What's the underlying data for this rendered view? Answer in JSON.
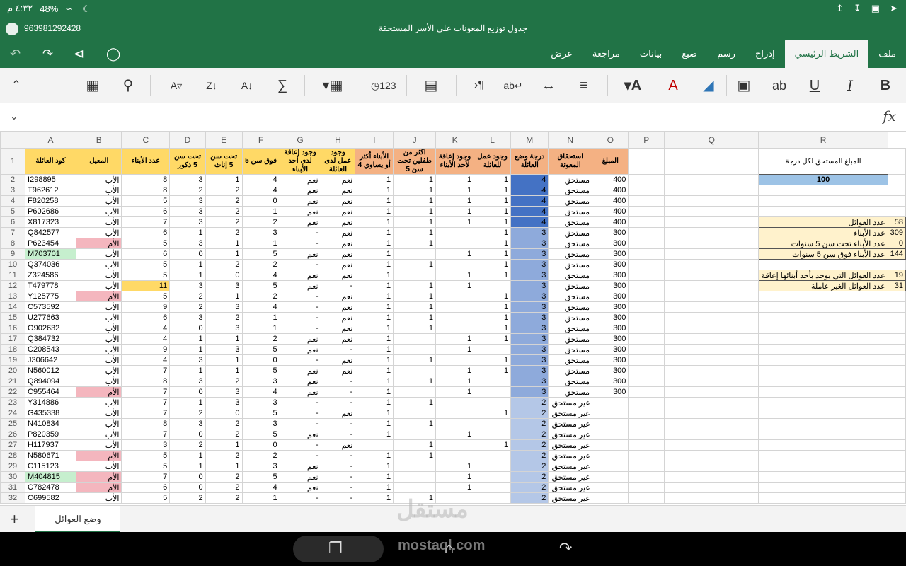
{
  "status": {
    "time": "٤:٣٢ م",
    "battery": "48%"
  },
  "title": {
    "phone": "963981292428",
    "doc": "جدول توزيع المعونات على الأسر المستحقة"
  },
  "menu": {
    "tabs": [
      "ملف",
      "الشريط الرئيسي",
      "إدراج",
      "رسم",
      "صيغ",
      "بيانات",
      "مراجعة",
      "عرض"
    ],
    "active": "الشريط الرئيسي"
  },
  "ribbon": {
    "icons": [
      "bold-icon",
      "italic-icon",
      "underline-icon",
      "strikethrough-icon",
      "borders-icon",
      "fill-color-icon",
      "font-color-icon",
      "font-color-dropdown-icon",
      "align-icon",
      "wrap-text-icon",
      "merge-icon",
      "rtl-icon",
      "format-icon",
      "number-format-icon",
      "insert-cells-icon",
      "autosum-icon",
      "sort-asc-icon",
      "sort-desc-icon",
      "filter-icon",
      "find-icon",
      "table-icon"
    ]
  },
  "formula": {
    "fx": "fx"
  },
  "columns": [
    "A",
    "B",
    "C",
    "D",
    "E",
    "F",
    "G",
    "H",
    "I",
    "J",
    "K",
    "L",
    "M",
    "N",
    "O",
    "P",
    "Q",
    "R"
  ],
  "headers": {
    "A": "كود العائلة",
    "B": "المعيل",
    "C": "عدد الأبناء",
    "D": "تحت سن 5 ذكور",
    "E": "تحت سن 5 إناث",
    "F": "فوق سن 5",
    "G": "وجود إعاقة لدى أحد الأبناء",
    "H": "وجود عمل لدى العائلة",
    "I": "الأبناء أكثر أو يساوي 4",
    "J": "أكثر من طفلين تحت سن 5",
    "K": "وجود إعاقة لأحد الأبناء",
    "L": "وجود عمل للعائلة",
    "M": "درجة وضع العائلة",
    "N": "استحقاق المعونة",
    "O": "المبلغ"
  },
  "rows": [
    {
      "r": "2",
      "A": "I298895",
      "B": "الأب",
      "C": "8",
      "D": "3",
      "E": "1",
      "F": "4",
      "G": "نعم",
      "H": "نعم",
      "I": "1",
      "J": "1",
      "K": "1",
      "L": "1",
      "M": "4",
      "N": "مستحق",
      "O": "400",
      "bc": "",
      "ac": ""
    },
    {
      "r": "3",
      "A": "T962612",
      "B": "الأب",
      "C": "8",
      "D": "2",
      "E": "2",
      "F": "4",
      "G": "نعم",
      "H": "نعم",
      "I": "1",
      "J": "1",
      "K": "1",
      "L": "1",
      "M": "4",
      "N": "مستحق",
      "O": "400",
      "bc": "",
      "ac": ""
    },
    {
      "r": "4",
      "A": "F820258",
      "B": "الأب",
      "C": "5",
      "D": "3",
      "E": "2",
      "F": "0",
      "G": "نعم",
      "H": "نعم",
      "I": "1",
      "J": "1",
      "K": "1",
      "L": "1",
      "M": "4",
      "N": "مستحق",
      "O": "400",
      "bc": "",
      "ac": ""
    },
    {
      "r": "5",
      "A": "P602686",
      "B": "الأب",
      "C": "6",
      "D": "3",
      "E": "2",
      "F": "1",
      "G": "نعم",
      "H": "نعم",
      "I": "1",
      "J": "1",
      "K": "1",
      "L": "1",
      "M": "4",
      "N": "مستحق",
      "O": "400",
      "bc": "",
      "ac": ""
    },
    {
      "r": "6",
      "A": "X817323",
      "B": "الأب",
      "C": "7",
      "D": "3",
      "E": "2",
      "F": "2",
      "G": "نعم",
      "H": "نعم",
      "I": "1",
      "J": "1",
      "K": "1",
      "L": "1",
      "M": "4",
      "N": "مستحق",
      "O": "400",
      "bc": "",
      "ac": ""
    },
    {
      "r": "7",
      "A": "Q842577",
      "B": "الأب",
      "C": "6",
      "D": "1",
      "E": "2",
      "F": "3",
      "G": "-",
      "H": "نعم",
      "I": "1",
      "J": "1",
      "K": "",
      "L": "1",
      "M": "3",
      "N": "مستحق",
      "O": "300",
      "bc": "",
      "ac": ""
    },
    {
      "r": "8",
      "A": "P623454",
      "B": "الأم",
      "C": "5",
      "D": "3",
      "E": "1",
      "F": "1",
      "G": "-",
      "H": "نعم",
      "I": "1",
      "J": "1",
      "K": "",
      "L": "1",
      "M": "3",
      "N": "مستحق",
      "O": "300",
      "bc": "pink",
      "ac": ""
    },
    {
      "r": "9",
      "A": "M703701",
      "B": "الأب",
      "C": "6",
      "D": "0",
      "E": "1",
      "F": "5",
      "G": "نعم",
      "H": "نعم",
      "I": "1",
      "J": "",
      "K": "1",
      "L": "1",
      "M": "3",
      "N": "مستحق",
      "O": "300",
      "bc": "",
      "ac": "green"
    },
    {
      "r": "10",
      "A": "Q374036",
      "B": "الأب",
      "C": "5",
      "D": "1",
      "E": "2",
      "F": "2",
      "G": "-",
      "H": "نعم",
      "I": "1",
      "J": "1",
      "K": "",
      "L": "1",
      "M": "3",
      "N": "مستحق",
      "O": "300",
      "bc": "",
      "ac": ""
    },
    {
      "r": "11",
      "A": "Z324586",
      "B": "الأب",
      "C": "5",
      "D": "1",
      "E": "0",
      "F": "4",
      "G": "نعم",
      "H": "نعم",
      "I": "1",
      "J": "",
      "K": "1",
      "L": "1",
      "M": "3",
      "N": "مستحق",
      "O": "300",
      "bc": "",
      "ac": ""
    },
    {
      "r": "12",
      "A": "T479778",
      "B": "الأب",
      "C": "11",
      "D": "3",
      "E": "3",
      "F": "5",
      "G": "نعم",
      "H": "-",
      "I": "1",
      "J": "1",
      "K": "1",
      "L": "",
      "M": "3",
      "N": "مستحق",
      "O": "300",
      "bc": "",
      "ac": "",
      "cc": "yellow"
    },
    {
      "r": "13",
      "A": "Y125775",
      "B": "الأم",
      "C": "5",
      "D": "2",
      "E": "1",
      "F": "2",
      "G": "-",
      "H": "نعم",
      "I": "1",
      "J": "1",
      "K": "",
      "L": "1",
      "M": "3",
      "N": "مستحق",
      "O": "300",
      "bc": "pink",
      "ac": ""
    },
    {
      "r": "14",
      "A": "C573592",
      "B": "الأب",
      "C": "9",
      "D": "2",
      "E": "3",
      "F": "4",
      "G": "-",
      "H": "نعم",
      "I": "1",
      "J": "1",
      "K": "",
      "L": "1",
      "M": "3",
      "N": "مستحق",
      "O": "300",
      "bc": "",
      "ac": ""
    },
    {
      "r": "15",
      "A": "U277663",
      "B": "الأب",
      "C": "6",
      "D": "3",
      "E": "2",
      "F": "1",
      "G": "-",
      "H": "نعم",
      "I": "1",
      "J": "1",
      "K": "",
      "L": "1",
      "M": "3",
      "N": "مستحق",
      "O": "300",
      "bc": "",
      "ac": ""
    },
    {
      "r": "16",
      "A": "O902632",
      "B": "الأب",
      "C": "4",
      "D": "0",
      "E": "3",
      "F": "1",
      "G": "-",
      "H": "نعم",
      "I": "1",
      "J": "1",
      "K": "",
      "L": "1",
      "M": "3",
      "N": "مستحق",
      "O": "300",
      "bc": "",
      "ac": ""
    },
    {
      "r": "17",
      "A": "Q384732",
      "B": "الأب",
      "C": "4",
      "D": "1",
      "E": "1",
      "F": "2",
      "G": "نعم",
      "H": "نعم",
      "I": "1",
      "J": "",
      "K": "1",
      "L": "1",
      "M": "3",
      "N": "مستحق",
      "O": "300",
      "bc": "",
      "ac": ""
    },
    {
      "r": "18",
      "A": "C208543",
      "B": "الأب",
      "C": "9",
      "D": "1",
      "E": "3",
      "F": "5",
      "G": "نعم",
      "H": "-",
      "I": "1",
      "J": "",
      "K": "1",
      "L": "",
      "M": "3",
      "N": "مستحق",
      "O": "300",
      "bc": "",
      "ac": ""
    },
    {
      "r": "19",
      "A": "J306642",
      "B": "الأب",
      "C": "4",
      "D": "3",
      "E": "1",
      "F": "0",
      "G": "-",
      "H": "نعم",
      "I": "1",
      "J": "1",
      "K": "",
      "L": "1",
      "M": "3",
      "N": "مستحق",
      "O": "300",
      "bc": "",
      "ac": ""
    },
    {
      "r": "20",
      "A": "N560012",
      "B": "الأب",
      "C": "7",
      "D": "1",
      "E": "1",
      "F": "5",
      "G": "نعم",
      "H": "نعم",
      "I": "1",
      "J": "",
      "K": "1",
      "L": "1",
      "M": "3",
      "N": "مستحق",
      "O": "300",
      "bc": "",
      "ac": ""
    },
    {
      "r": "21",
      "A": "Q894094",
      "B": "الأب",
      "C": "8",
      "D": "3",
      "E": "2",
      "F": "3",
      "G": "نعم",
      "H": "-",
      "I": "1",
      "J": "1",
      "K": "1",
      "L": "",
      "M": "3",
      "N": "مستحق",
      "O": "300",
      "bc": "",
      "ac": ""
    },
    {
      "r": "22",
      "A": "C955464",
      "B": "الأم",
      "C": "7",
      "D": "0",
      "E": "3",
      "F": "4",
      "G": "نعم",
      "H": "-",
      "I": "1",
      "J": "",
      "K": "1",
      "L": "",
      "M": "3",
      "N": "مستحق",
      "O": "300",
      "bc": "pink",
      "ac": ""
    },
    {
      "r": "23",
      "A": "Y314886",
      "B": "الأب",
      "C": "7",
      "D": "1",
      "E": "3",
      "F": "3",
      "G": "-",
      "H": "-",
      "I": "1",
      "J": "1",
      "K": "",
      "L": "",
      "M": "2",
      "N": "غير مستحق",
      "O": "",
      "bc": "",
      "ac": ""
    },
    {
      "r": "24",
      "A": "G435338",
      "B": "الأب",
      "C": "7",
      "D": "2",
      "E": "0",
      "F": "5",
      "G": "-",
      "H": "نعم",
      "I": "1",
      "J": "",
      "K": "",
      "L": "1",
      "M": "2",
      "N": "غير مستحق",
      "O": "",
      "bc": "",
      "ac": ""
    },
    {
      "r": "25",
      "A": "N410834",
      "B": "الأب",
      "C": "8",
      "D": "3",
      "E": "2",
      "F": "3",
      "G": "-",
      "H": "-",
      "I": "1",
      "J": "1",
      "K": "",
      "L": "",
      "M": "2",
      "N": "غير مستحق",
      "O": "",
      "bc": "",
      "ac": ""
    },
    {
      "r": "26",
      "A": "P820359",
      "B": "الأب",
      "C": "7",
      "D": "0",
      "E": "2",
      "F": "5",
      "G": "نعم",
      "H": "-",
      "I": "1",
      "J": "",
      "K": "1",
      "L": "",
      "M": "2",
      "N": "غير مستحق",
      "O": "",
      "bc": "",
      "ac": ""
    },
    {
      "r": "27",
      "A": "H117937",
      "B": "الأب",
      "C": "3",
      "D": "2",
      "E": "1",
      "F": "0",
      "G": "-",
      "H": "نعم",
      "I": "",
      "J": "1",
      "K": "",
      "L": "1",
      "M": "2",
      "N": "غير مستحق",
      "O": "",
      "bc": "",
      "ac": ""
    },
    {
      "r": "28",
      "A": "N580671",
      "B": "الأم",
      "C": "5",
      "D": "1",
      "E": "2",
      "F": "2",
      "G": "-",
      "H": "-",
      "I": "1",
      "J": "1",
      "K": "",
      "L": "",
      "M": "2",
      "N": "غير مستحق",
      "O": "",
      "bc": "pink",
      "ac": ""
    },
    {
      "r": "29",
      "A": "C115123",
      "B": "الأب",
      "C": "5",
      "D": "1",
      "E": "1",
      "F": "3",
      "G": "نعم",
      "H": "-",
      "I": "1",
      "J": "",
      "K": "1",
      "L": "",
      "M": "2",
      "N": "غير مستحق",
      "O": "",
      "bc": "",
      "ac": ""
    },
    {
      "r": "30",
      "A": "M404815",
      "B": "الأم",
      "C": "7",
      "D": "0",
      "E": "2",
      "F": "5",
      "G": "نعم",
      "H": "-",
      "I": "1",
      "J": "",
      "K": "1",
      "L": "",
      "M": "2",
      "N": "غير مستحق",
      "O": "",
      "bc": "pink",
      "ac": "green"
    },
    {
      "r": "31",
      "A": "C782478",
      "B": "الأم",
      "C": "6",
      "D": "0",
      "E": "2",
      "F": "4",
      "G": "نعم",
      "H": "-",
      "I": "1",
      "J": "",
      "K": "1",
      "L": "",
      "M": "2",
      "N": "غير مستحق",
      "O": "",
      "bc": "pink",
      "ac": ""
    },
    {
      "r": "32",
      "A": "C699582",
      "B": "الأب",
      "C": "5",
      "D": "2",
      "E": "2",
      "F": "1",
      "G": "-",
      "H": "-",
      "I": "1",
      "J": "1",
      "K": "",
      "L": "",
      "M": "2",
      "N": "غير مستحق",
      "O": "",
      "bc": "",
      "ac": ""
    }
  ],
  "side": {
    "q_header": "المبلغ المستحق لكل درجة",
    "q_value": "100",
    "stats": [
      {
        "label": "عدد العوائل",
        "value": "58"
      },
      {
        "label": "عدد الأبناء",
        "value": "309"
      },
      {
        "label": "عدد الأبناء تحت سن 5 سنوات",
        "value": "0"
      },
      {
        "label": "عدد الأبناء فوق سن 5 سنوات",
        "value": "144"
      }
    ],
    "stats2": [
      {
        "label": "عدد العوائل التي يوجد بأحد أبنائها إعاقة",
        "value": "19"
      },
      {
        "label": "عدد العوائل الغير عاملة",
        "value": "31"
      }
    ]
  },
  "sheet": {
    "tab": "وضع العوائل"
  },
  "watermark": {
    "ar": "مستقل",
    "en": "mostaql.com"
  }
}
